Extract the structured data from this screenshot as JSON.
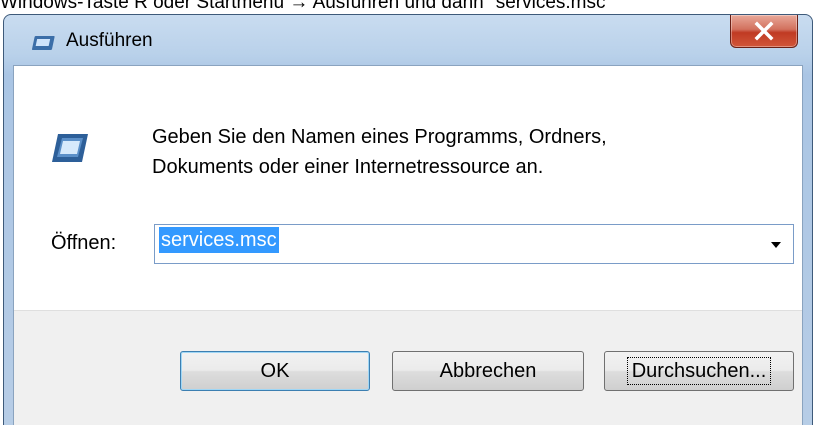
{
  "caption": {
    "text": "Windows-Taste R oder Startmenü → Ausführen und dann \"services.msc\""
  },
  "window": {
    "title": "Ausführen",
    "close_glyph": "X"
  },
  "dialog": {
    "description_line1": "Geben Sie den Namen eines Programms, Ordners,",
    "description_line2": "Dokuments oder einer Internetressource an.",
    "open_label": "Öffnen:",
    "open_value": "services.msc"
  },
  "buttons": {
    "ok": "OK",
    "cancel": "Abbrechen",
    "browse": "Durchsuchen..."
  },
  "icons": {
    "window": "run-icon",
    "close": "close-icon",
    "dropdown": "chevron-down-icon"
  },
  "colors": {
    "selection": "#3399ff",
    "close_red": "#c03a23",
    "focus_border": "#3c7fb1"
  }
}
